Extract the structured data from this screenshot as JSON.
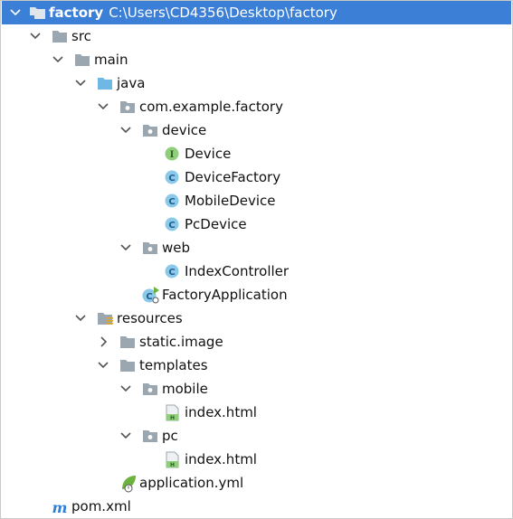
{
  "tree": {
    "root": {
      "name": "factory",
      "path": "C:\\Users\\CD4356\\Desktop\\factory"
    },
    "items": [
      {
        "label": "src"
      },
      {
        "label": "main"
      },
      {
        "label": "java"
      },
      {
        "label": "com.example.factory"
      },
      {
        "label": "device"
      },
      {
        "label": "Device"
      },
      {
        "label": "DeviceFactory"
      },
      {
        "label": "MobileDevice"
      },
      {
        "label": "PcDevice"
      },
      {
        "label": "web"
      },
      {
        "label": "IndexController"
      },
      {
        "label": "FactoryApplication"
      },
      {
        "label": "resources"
      },
      {
        "label": "static.image"
      },
      {
        "label": "templates"
      },
      {
        "label": "mobile"
      },
      {
        "label": "index.html"
      },
      {
        "label": "pc"
      },
      {
        "label": "index.html"
      },
      {
        "label": "application.yml"
      },
      {
        "label": "pom.xml"
      }
    ]
  },
  "colors": {
    "selection": "#3b7fd6",
    "folder": "#9aa7b0",
    "source_folder": "#6fb8e3",
    "class_icon": "#8bc9eb",
    "interface_icon": "#8fcf7b",
    "spring_green": "#6cb33e",
    "maven_m": "#2f7fd9"
  }
}
